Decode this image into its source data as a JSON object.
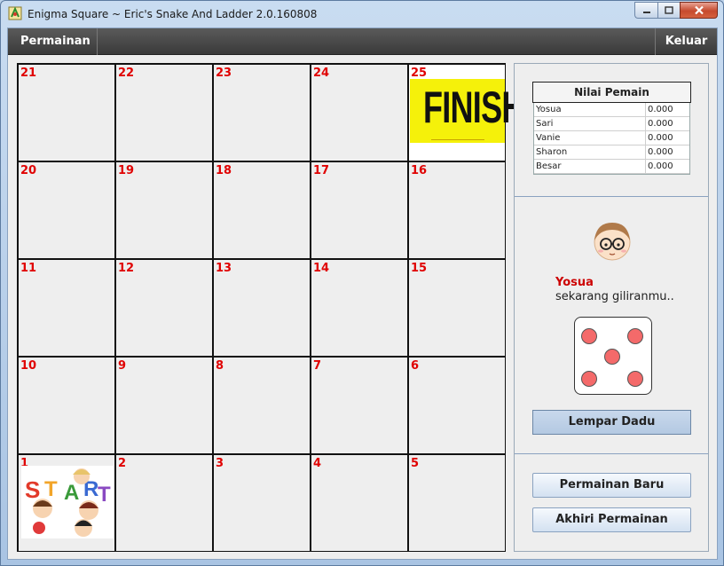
{
  "window": {
    "title": "Enigma Square ~ Eric's Snake And Ladder 2.0.160808"
  },
  "menu": {
    "left": "Permainan",
    "right": "Keluar"
  },
  "board": {
    "rows": [
      [
        "21",
        "22",
        "23",
        "24",
        "25"
      ],
      [
        "20",
        "19",
        "18",
        "17",
        "16"
      ],
      [
        "11",
        "12",
        "13",
        "14",
        "15"
      ],
      [
        "10",
        "9",
        "8",
        "7",
        "6"
      ],
      [
        "1",
        "2",
        "3",
        "4",
        "5"
      ]
    ],
    "finish_label": "FINISH",
    "start_label": "START",
    "number_color": "#e00000"
  },
  "scores": {
    "header": "Nilai Pemain",
    "players": [
      {
        "name": "Yosua",
        "value": "0.000"
      },
      {
        "name": "Sari",
        "value": "0.000"
      },
      {
        "name": "Vanie",
        "value": "0.000"
      },
      {
        "name": "Sharon",
        "value": "0.000"
      },
      {
        "name": "Besar",
        "value": "0.000"
      }
    ]
  },
  "turn": {
    "player": "Yosua",
    "message": "sekarang giliranmu..",
    "dice_value": 5
  },
  "buttons": {
    "roll": "Lempar Dadu",
    "new_game": "Permainan Baru",
    "end_game": "Akhiri Permainan"
  },
  "icons": {
    "app": "app-icon",
    "minimize": "minimize-icon",
    "maximize": "maximize-icon",
    "close": "close-icon"
  }
}
